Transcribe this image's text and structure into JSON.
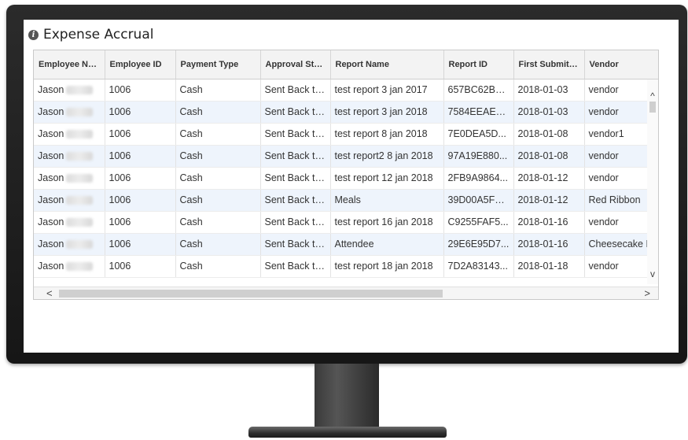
{
  "panel": {
    "title": "Expense Accrual",
    "icon": "info-icon"
  },
  "columns": [
    "Employee Nam...",
    "Employee ID",
    "Payment Type",
    "Approval Stat...",
    "Report Name",
    "Report ID",
    "First Submit D...",
    "Vendor"
  ],
  "rows": [
    [
      "Jason",
      "1006",
      "Cash",
      "Sent Back to...",
      "test report 3 jan 2017",
      "657BC62BB...",
      "2018-01-03",
      "vendor"
    ],
    [
      "Jason",
      "1006",
      "Cash",
      "Sent Back to...",
      "test report 3 jan 2018",
      "7584EEAED...",
      "2018-01-03",
      "vendor"
    ],
    [
      "Jason",
      "1006",
      "Cash",
      "Sent Back to...",
      "test report 8 jan 2018",
      "7E0DEA5D...",
      "2018-01-08",
      "vendor1"
    ],
    [
      "Jason",
      "1006",
      "Cash",
      "Sent Back to...",
      "test report2 8 jan 2018",
      "97A19E880...",
      "2018-01-08",
      "vendor"
    ],
    [
      "Jason",
      "1006",
      "Cash",
      "Sent Back to...",
      "test report 12 jan 2018",
      "2FB9A9864...",
      "2018-01-12",
      "vendor"
    ],
    [
      "Jason",
      "1006",
      "Cash",
      "Sent Back to...",
      "Meals",
      "39D00A5FC...",
      "2018-01-12",
      "Red Ribbon"
    ],
    [
      "Jason",
      "1006",
      "Cash",
      "Sent Back to...",
      "test report 16 jan 2018",
      "C9255FAF5...",
      "2018-01-16",
      "vendor"
    ],
    [
      "Jason",
      "1006",
      "Cash",
      "Sent Back to...",
      "Attendee",
      "29E6E95D7...",
      "2018-01-16",
      "Cheesecake F"
    ],
    [
      "Jason",
      "1006",
      "Cash",
      "Sent Back to...",
      "test report 18 jan 2018",
      "7D2A83143...",
      "2018-01-18",
      "vendor"
    ]
  ],
  "scroll": {
    "up": "^",
    "down": "v",
    "left": "<",
    "right": ">"
  },
  "colors": {
    "row_alt": "#eef4fc",
    "header_bg": "#f3f3f3",
    "monitor": "#1e1e1e"
  }
}
